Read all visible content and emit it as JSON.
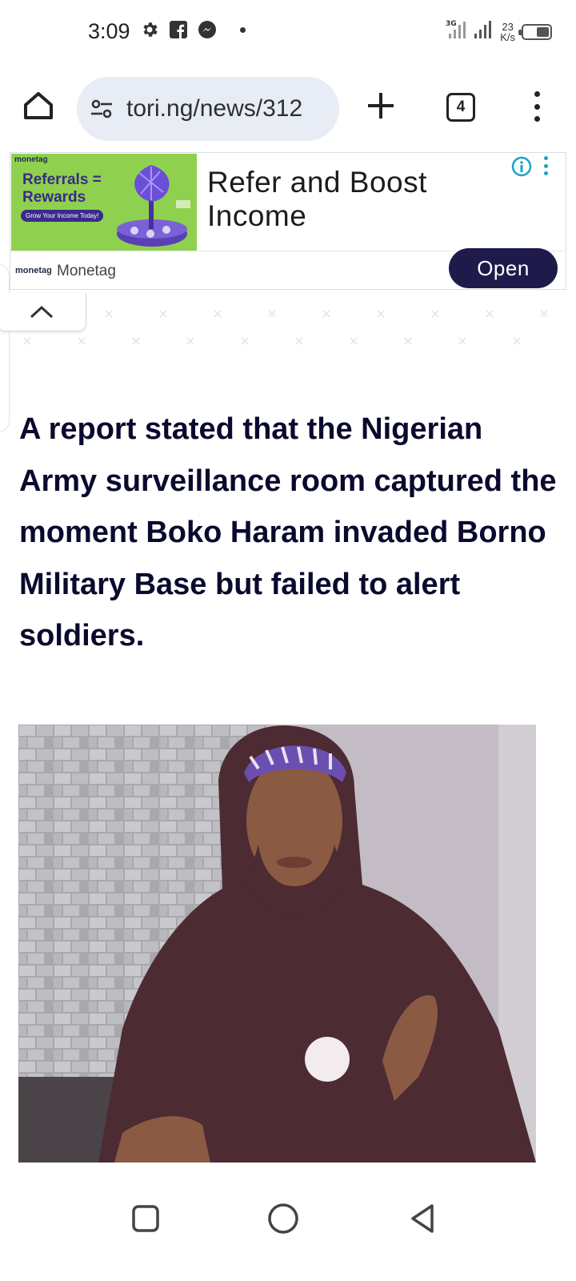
{
  "status_bar": {
    "time": "3:09",
    "network_type": "3G",
    "net_speed_value": "23",
    "net_speed_unit": "K/s",
    "battery_level": 0.45
  },
  "browser": {
    "url": "tori.ng/news/312",
    "tab_count": "4"
  },
  "ad": {
    "image_brand": "monetag",
    "image_title_line1": "Referrals =",
    "image_title_line2": "Rewards",
    "image_cta": "Grow Your Income Today!",
    "headline": "Refer and Boost Income",
    "footer_logo": "monetag",
    "advertiser": "Monetag",
    "open_label": "Open",
    "accent_color": "#1aa3c8",
    "button_color": "#1e1b4b"
  },
  "article": {
    "headline": "A report stated that the Nigerian Army surveillance room captured the moment Boko Haram invaded Borno Military Base but failed to alert soldiers."
  },
  "icons": [
    "settings-icon",
    "facebook-icon",
    "messenger-icon",
    "signal-icon",
    "battery-icon",
    "home-icon",
    "site-settings-icon",
    "plus-icon",
    "more-vert-icon",
    "info-icon",
    "chevron-up-icon",
    "recents-icon",
    "home-circle-icon",
    "back-icon"
  ]
}
